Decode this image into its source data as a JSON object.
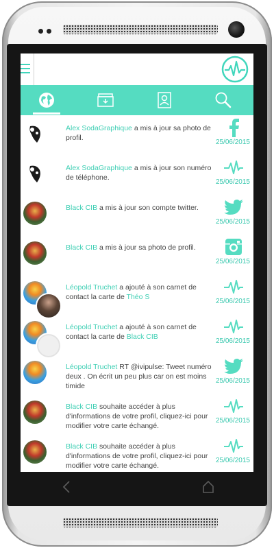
{
  "colors": {
    "accent": "#55dcc1",
    "accent_text": "#3fcfb4",
    "date": "#35c7ad"
  },
  "tabs": [
    {
      "name": "globe-icon",
      "active": true
    },
    {
      "name": "inbox-icon",
      "active": false
    },
    {
      "name": "contact-card-icon",
      "active": false
    },
    {
      "name": "search-icon",
      "active": false
    }
  ],
  "feed": [
    {
      "avatar": "panda",
      "who": "Alex SodaGraphique",
      "text": " a mis à jour sa photo de profil.",
      "icon": "facebook-icon",
      "date": "25/06/2015"
    },
    {
      "avatar": "panda",
      "who": "Alex SodaGraphique",
      "text": " a mis à jour son numéro de téléphone.",
      "icon": "pulse-icon",
      "date": "25/06/2015"
    },
    {
      "avatar": "cib",
      "who": "Black CIB",
      "text": " a mis à jour son compte twitter.",
      "icon": "twitter-icon",
      "date": "25/06/2015"
    },
    {
      "avatar": "cib",
      "who": "Black CIB",
      "text": " a mis à jour sa photo de profil.",
      "icon": "instagram-icon",
      "date": "25/06/2015"
    },
    {
      "avatar": "leo",
      "avatar2": "photo",
      "who": "Léopold Truchet",
      "text": " a ajouté à son carnet de contact la carte de ",
      "link": "Théo S",
      "icon": "pulse-icon",
      "date": "25/06/2015"
    },
    {
      "avatar": "leo",
      "avatar2": "ghost",
      "who": "Léopold Truchet",
      "text": " a ajouté à son carnet de contact la carte de ",
      "link": "Black CIB",
      "icon": "pulse-icon",
      "date": "25/06/2015"
    },
    {
      "avatar": "leo",
      "who": "Léopold Truchet",
      "text": " RT @ivipulse: Tweet numéro deux . On écrit un peu plus car on est moins timide",
      "icon": "twitter-icon",
      "date": "25/06/2015"
    },
    {
      "avatar": "cib",
      "who": "Black CIB",
      "text": " souhaite accéder à plus d'informations de votre profil, cliquez-ici pour modifier votre carte échangé.",
      "icon": "pulse-icon",
      "date": "25/06/2015"
    },
    {
      "avatar": "cib",
      "who": "Black CIB",
      "text": " souhaite accéder à plus d'informations de votre profil, cliquez-ici pour modifier votre carte échangé.",
      "icon": "pulse-icon",
      "date": "25/06/2015"
    }
  ]
}
